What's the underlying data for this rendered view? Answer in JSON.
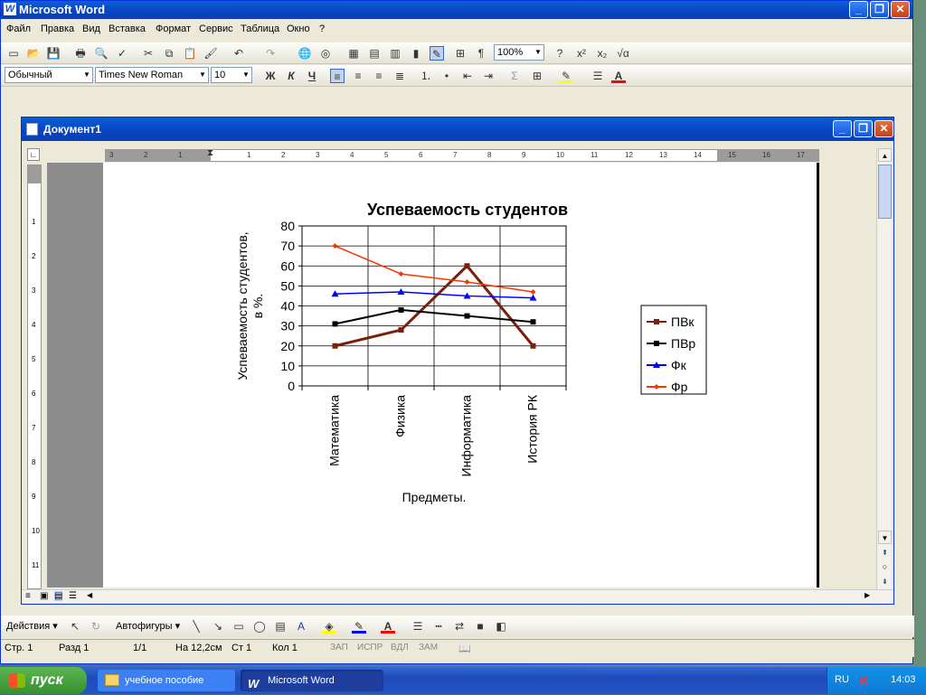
{
  "app": {
    "title": "Microsoft Word"
  },
  "menu": [
    "Файл",
    "Правка",
    "Вид",
    "Вставка",
    "Формат",
    "Сервис",
    "Таблица",
    "Окно",
    "?"
  ],
  "toolbar": {
    "zoom": "100%",
    "style": "Обычный",
    "font": "Times New Roman",
    "size": "10",
    "bold": "Ж",
    "italic": "К",
    "underline": "Ч"
  },
  "document": {
    "title": "Документ1"
  },
  "chart_data": {
    "type": "line",
    "title": "Успеваемость студентов",
    "xlabel": "Предметы.",
    "ylabel_line1": "Успеваемость студентов,",
    "ylabel_line2": "в %.",
    "categories": [
      "Математика",
      "Физика",
      "Информатика",
      "История РК"
    ],
    "ylim": [
      0,
      80
    ],
    "yticks": [
      "0",
      "10",
      "20",
      "30",
      "40",
      "50",
      "60",
      "70",
      "80"
    ],
    "grid": true,
    "legend_position": "right",
    "series": [
      {
        "name": "ПВк",
        "values": [
          20,
          28,
          60,
          20
        ],
        "color": "#7a1f0a",
        "marker": "square"
      },
      {
        "name": "ПВр",
        "values": [
          31,
          38,
          35,
          32
        ],
        "color": "#000000",
        "marker": "square"
      },
      {
        "name": "Фк",
        "values": [
          46,
          47,
          45,
          44
        ],
        "color": "#0000ff",
        "marker": "triangle"
      },
      {
        "name": "Фр",
        "values": [
          70,
          56,
          52,
          47
        ],
        "color": "#ff3300",
        "marker": "diamond"
      }
    ]
  },
  "drawing": {
    "actions": "Действия",
    "autoshapes": "Автофигуры"
  },
  "status": {
    "page": "Стр. 1",
    "section": "Разд 1",
    "pages": "1/1",
    "at": "На 12,2см",
    "line": "Ст 1",
    "col": "Кол 1",
    "rec": "ЗАП",
    "trk": "ИСПР",
    "ext": "ВДЛ",
    "ovr": "ЗАМ"
  },
  "taskbar": {
    "start": "пуск",
    "task1": "учебное пособие",
    "task2": "Microsoft Word",
    "lang": "RU",
    "clock": "14:03"
  }
}
